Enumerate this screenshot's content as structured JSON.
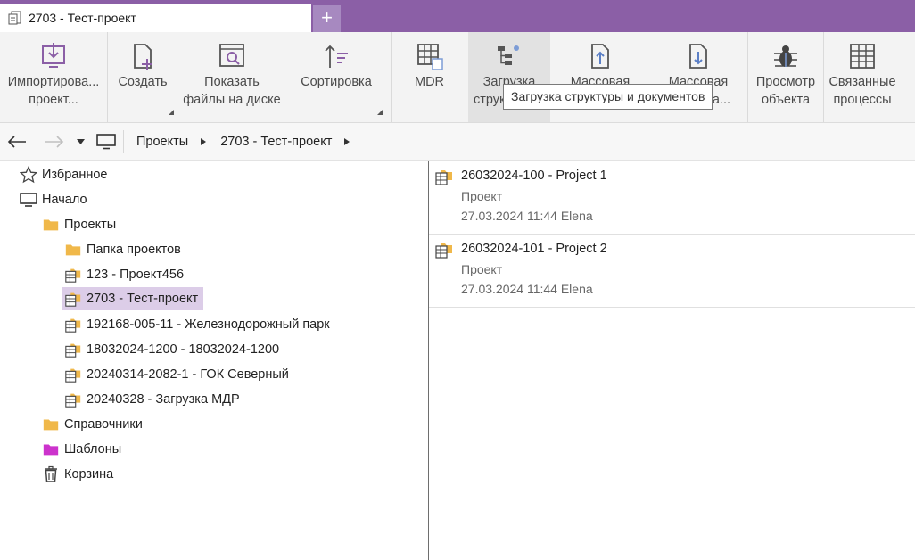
{
  "tab": {
    "title": "2703 - Тест-проект",
    "new_tab_symbol": "+"
  },
  "ribbon": {
    "buttons": [
      {
        "label": "Импортирова...\nпроект...",
        "icon": "import-icon"
      },
      {
        "label": "Создать",
        "icon": "new-file-icon"
      },
      {
        "label": "Показать\nфайлы на диске",
        "icon": "browse-disk-icon"
      },
      {
        "label": "Сортировка",
        "icon": "sort-icon"
      },
      {
        "label": "MDR",
        "icon": "mdr-table-icon"
      },
      {
        "label": "Загрузка\nструктуры...",
        "icon": "structure-load-icon"
      },
      {
        "label": "Массовая\nзагрузка...",
        "icon": "upload-icon"
      },
      {
        "label": "Массовая\nвыгрузка...",
        "icon": "download-icon"
      },
      {
        "label": "Просмотр\nобъекта",
        "icon": "bug-icon"
      },
      {
        "label": "Связанные\nпроцессы",
        "icon": "grid-icon"
      }
    ],
    "tooltip": "Загрузка структуры и документов"
  },
  "nav": {
    "breadcrumbs": [
      "Проекты",
      "2703 - Тест-проект"
    ]
  },
  "tree": {
    "items": [
      {
        "label": "Избранное",
        "icon": "star-icon"
      },
      {
        "label": "Начало",
        "icon": "monitor-icon"
      },
      {
        "label": "Проекты",
        "icon": "folder-icon"
      },
      {
        "label": "Папка проектов",
        "icon": "folder-icon"
      },
      {
        "label": "123 - Проект456",
        "icon": "project-icon"
      },
      {
        "label": "2703 - Тест-проект",
        "icon": "project-icon",
        "selected": true
      },
      {
        "label": "192168-005-11 - Железнодорожный парк",
        "icon": "project-icon"
      },
      {
        "label": "18032024-1200 - 18032024-1200",
        "icon": "project-icon"
      },
      {
        "label": "20240314-2082-1 - ГОК Северный",
        "icon": "project-icon"
      },
      {
        "label": "20240328 - Загрузка МДР",
        "icon": "project-icon"
      },
      {
        "label": "Справочники",
        "icon": "folder-icon"
      },
      {
        "label": "Шаблоны",
        "icon": "magenta-folder-icon"
      },
      {
        "label": "Корзина",
        "icon": "trash-icon"
      }
    ]
  },
  "list": {
    "items": [
      {
        "title": "26032024-100 - Project 1",
        "type": "Проект",
        "meta": "27.03.2024 11:44 Elena"
      },
      {
        "title": "26032024-101 - Project 2",
        "type": "Проект",
        "meta": "27.03.2024 11:44 Elena"
      }
    ]
  },
  "colors": {
    "accent": "#8b5fa6",
    "selection": "#dccde8",
    "folder": "#f0b84a",
    "template_folder": "#cc33cc"
  }
}
